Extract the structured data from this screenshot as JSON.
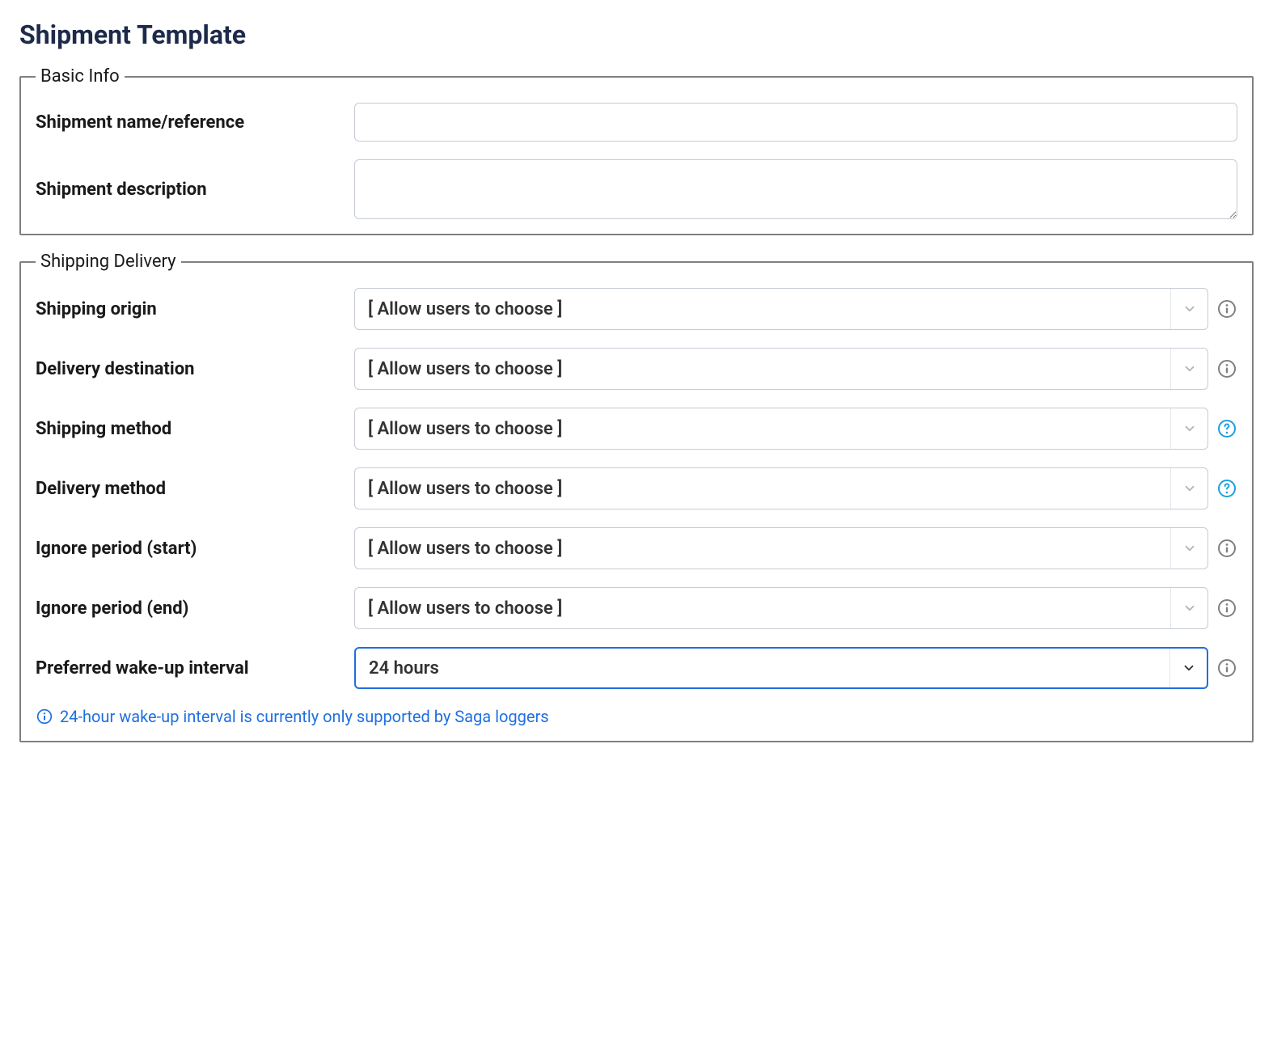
{
  "page": {
    "title": "Shipment Template"
  },
  "basic_info": {
    "legend": "Basic Info",
    "name_label": "Shipment name/reference",
    "name_value": "",
    "desc_label": "Shipment description",
    "desc_value": ""
  },
  "shipping_delivery": {
    "legend": "Shipping Delivery",
    "origin_label": "Shipping origin",
    "origin_value": "[ Allow users to choose ]",
    "destination_label": "Delivery destination",
    "destination_value": "[ Allow users to choose ]",
    "shipping_method_label": "Shipping method",
    "shipping_method_value": "[ Allow users to choose ]",
    "delivery_method_label": "Delivery method",
    "delivery_method_value": "[ Allow users to choose ]",
    "ignore_start_label": "Ignore period (start)",
    "ignore_start_value": "[ Allow users to choose ]",
    "ignore_end_label": "Ignore period (end)",
    "ignore_end_value": "[ Allow users to choose ]",
    "wakeup_label": "Preferred wake-up interval",
    "wakeup_value": "24 hours",
    "info_message": "24-hour wake-up interval is currently only supported by Saga loggers"
  },
  "icons": {
    "info_gray": "#808080",
    "info_blue": "#1f9fe0",
    "help_blue": "#1f9fe0",
    "caret_gray": "#b0b5bd",
    "caret_dark": "#333"
  }
}
